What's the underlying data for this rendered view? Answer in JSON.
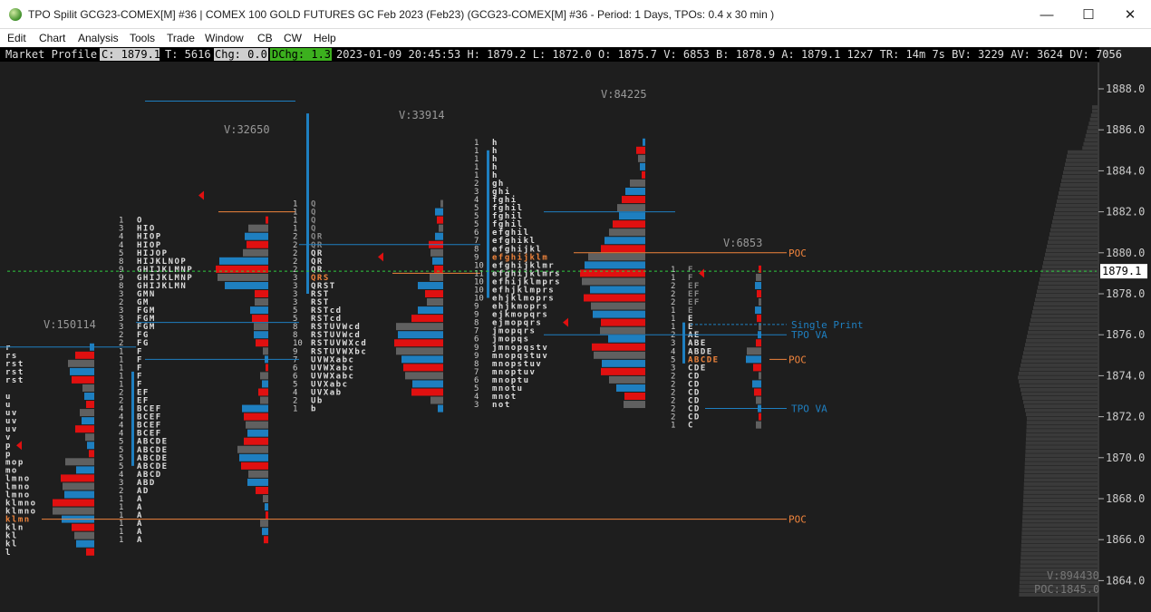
{
  "window": {
    "title": "TPO Spilit GCG23-COMEX[M] #36 | COMEX 100 GOLD FUTURES GC Feb 2023 (Feb23) (GCG23-COMEX[M] #36 - Period: 1 Days, TPOs: 0.4 x 30 min  )",
    "minimize": "—",
    "maximize": "☐",
    "close": "✕",
    "app_icon": "globe-icon"
  },
  "menu": [
    "Edit",
    "Chart",
    "Analysis",
    "Tools",
    "Trade",
    "Window",
    "CB",
    "CW",
    "Help"
  ],
  "status": {
    "label": "Market Profile",
    "c": "C: 1879.1",
    "t": "T: 5616",
    "chg": "Chg: 0.0",
    "dchg": "DChg: 1.3",
    "rest": "2023-01-09 20:45:53 H: 1879.2 L: 1872.0 O: 1875.7 V: 6853 B: 1878.9 A: 1879.1 12x7 TR: 14m 7s BV: 3229 AV: 3624 DV: 7056"
  },
  "price_axis": {
    "ticks": [
      "1888.0",
      "1886.0",
      "1884.0",
      "1882.0",
      "1880.0",
      "1878.0",
      "1876.0",
      "1874.0",
      "1872.0",
      "1870.0",
      "1868.0",
      "1866.0",
      "1864.0"
    ],
    "current": "1879.1"
  },
  "volume_labels": [
    "V:150114",
    "V:32650",
    "V:33914",
    "V:84225",
    "V:6853"
  ],
  "annotations": {
    "poc": "POC",
    "tpo_va": "TPO VA",
    "single_print": "Single Print"
  },
  "footer": {
    "total_volume": "V:894430",
    "poc_price": "POC:1845.0"
  },
  "colors": {
    "background": "#1e1e1e",
    "blue": "#1e7fc0",
    "red": "#e01010",
    "gray": "#606060",
    "orange": "#f0843c",
    "green_dotted": "#2ecc40",
    "status_green": "#3cb01e"
  },
  "profiles": [
    {
      "rows": [
        {
          "c": "",
          "l": "r"
        },
        {
          "c": "",
          "l": "rs"
        },
        {
          "c": "",
          "l": "rst"
        },
        {
          "c": "",
          "l": "rst"
        },
        {
          "c": "",
          "l": "rst"
        },
        {
          "c": "",
          "l": ""
        },
        {
          "c": "",
          "l": "u"
        },
        {
          "c": "",
          "l": "u"
        },
        {
          "c": "",
          "l": "uv"
        },
        {
          "c": "",
          "l": "uv"
        },
        {
          "c": "",
          "l": "uv"
        },
        {
          "c": "",
          "l": "v"
        },
        {
          "c": "",
          "l": "p"
        },
        {
          "c": "",
          "l": "p"
        },
        {
          "c": "",
          "l": "mop"
        },
        {
          "c": "",
          "l": "mo"
        },
        {
          "c": "",
          "l": "lmno"
        },
        {
          "c": "",
          "l": "lmno"
        },
        {
          "c": "",
          "l": "lmno"
        },
        {
          "c": "",
          "l": "klmno"
        },
        {
          "c": "",
          "l": "klmno"
        },
        {
          "c": "",
          "l": "klmn"
        },
        {
          "c": "",
          "l": "kln"
        },
        {
          "c": "",
          "l": "kl"
        },
        {
          "c": "",
          "l": "kl"
        },
        {
          "c": "",
          "l": "l"
        }
      ]
    },
    {
      "rows": [
        {
          "c": "1",
          "l": "O"
        },
        {
          "c": "3",
          "l": "HIO"
        },
        {
          "c": "4",
          "l": "HIOP"
        },
        {
          "c": "4",
          "l": "HIOP"
        },
        {
          "c": "5",
          "l": "HIJOP"
        },
        {
          "c": "8",
          "l": "HIJKLNOP"
        },
        {
          "c": "9",
          "l": "GHIJKLMNP"
        },
        {
          "c": "9",
          "l": "GHIJKLMNP"
        },
        {
          "c": "8",
          "l": "GHIJKLMN"
        },
        {
          "c": "3",
          "l": "GMN"
        },
        {
          "c": "2",
          "l": "GM"
        },
        {
          "c": "3",
          "l": "FGM"
        },
        {
          "c": "3",
          "l": "FGM"
        },
        {
          "c": "3",
          "l": "FGM"
        },
        {
          "c": "2",
          "l": "FG"
        },
        {
          "c": "2",
          "l": "FG"
        },
        {
          "c": "1",
          "l": "F"
        },
        {
          "c": "1",
          "l": "F"
        },
        {
          "c": "1",
          "l": "F"
        },
        {
          "c": "1",
          "l": "F"
        },
        {
          "c": "1",
          "l": "F"
        },
        {
          "c": "2",
          "l": "EF"
        },
        {
          "c": "2",
          "l": "EF"
        },
        {
          "c": "4",
          "l": "BCEF"
        },
        {
          "c": "4",
          "l": "BCEF"
        },
        {
          "c": "4",
          "l": "BCEF"
        },
        {
          "c": "4",
          "l": "BCEF"
        },
        {
          "c": "5",
          "l": "ABCDE"
        },
        {
          "c": "5",
          "l": "ABCDE"
        },
        {
          "c": "5",
          "l": "ABCDE"
        },
        {
          "c": "5",
          "l": "ABCDE"
        },
        {
          "c": "4",
          "l": "ABCD"
        },
        {
          "c": "3",
          "l": "ABD"
        },
        {
          "c": "2",
          "l": "AD"
        },
        {
          "c": "1",
          "l": "A"
        },
        {
          "c": "1",
          "l": "A"
        },
        {
          "c": "1",
          "l": "A"
        },
        {
          "c": "1",
          "l": "A"
        },
        {
          "c": "1",
          "l": "A"
        },
        {
          "c": "1",
          "l": "A"
        }
      ]
    },
    {
      "rows": [
        {
          "c": "1",
          "l": "Q"
        },
        {
          "c": "1",
          "l": "Q"
        },
        {
          "c": "1",
          "l": "Q"
        },
        {
          "c": "1",
          "l": "Q"
        },
        {
          "c": "2",
          "l": "QR"
        },
        {
          "c": "2",
          "l": "QR"
        },
        {
          "c": "2",
          "l": "QR"
        },
        {
          "c": "2",
          "l": "QR"
        },
        {
          "c": "2",
          "l": "QR"
        },
        {
          "c": "3",
          "l": "QRS"
        },
        {
          "c": "3",
          "l": "QRST"
        },
        {
          "c": "3",
          "l": "RST"
        },
        {
          "c": "3",
          "l": "RST"
        },
        {
          "c": "5",
          "l": "RSTcd"
        },
        {
          "c": "5",
          "l": "RSTcd"
        },
        {
          "c": "8",
          "l": "RSTUVWcd"
        },
        {
          "c": "8",
          "l": "RSTUVWcd"
        },
        {
          "c": "10",
          "l": "RSTUVWXcd"
        },
        {
          "c": "9",
          "l": "RSTUVWXbc"
        },
        {
          "c": "7",
          "l": "UVWXabc"
        },
        {
          "c": "6",
          "l": "UVWXabc"
        },
        {
          "c": "6",
          "l": "UVWXabc"
        },
        {
          "c": "5",
          "l": "UVXabc"
        },
        {
          "c": "4",
          "l": "UVXab"
        },
        {
          "c": "2",
          "l": "Ub"
        },
        {
          "c": "1",
          "l": "b"
        }
      ]
    },
    {
      "rows": [
        {
          "c": "1",
          "l": "h"
        },
        {
          "c": "1",
          "l": "h"
        },
        {
          "c": "1",
          "l": "h"
        },
        {
          "c": "1",
          "l": "h"
        },
        {
          "c": "1",
          "l": "h"
        },
        {
          "c": "2",
          "l": "gh"
        },
        {
          "c": "3",
          "l": "ghi"
        },
        {
          "c": "4",
          "l": "fghi"
        },
        {
          "c": "5",
          "l": "fghil"
        },
        {
          "c": "5",
          "l": "fghil"
        },
        {
          "c": "5",
          "l": "fghil"
        },
        {
          "c": "6",
          "l": "efghil"
        },
        {
          "c": "7",
          "l": "efghikl"
        },
        {
          "c": "8",
          "l": "efghijkl"
        },
        {
          "c": "9",
          "l": "efghijklm"
        },
        {
          "c": "10",
          "l": "efghijklmr"
        },
        {
          "c": "11",
          "l": "efghijklmrs"
        },
        {
          "c": "10",
          "l": "efhijklmprs"
        },
        {
          "c": "10",
          "l": "efhjklmprs"
        },
        {
          "c": "10",
          "l": "ehjklmoprs"
        },
        {
          "c": "9",
          "l": "ehjkmoprs"
        },
        {
          "c": "9",
          "l": "ejkmopqrs"
        },
        {
          "c": "8",
          "l": "ejmopqrs"
        },
        {
          "c": "7",
          "l": "jmopqrs"
        },
        {
          "c": "6",
          "l": "jmopqs"
        },
        {
          "c": "9",
          "l": "jmnopqstv"
        },
        {
          "c": "9",
          "l": "mnopqstuv"
        },
        {
          "c": "8",
          "l": "mnopstuv"
        },
        {
          "c": "7",
          "l": "mnoptuv"
        },
        {
          "c": "6",
          "l": "mnoptu"
        },
        {
          "c": "5",
          "l": "mnotu"
        },
        {
          "c": "4",
          "l": "mnot"
        },
        {
          "c": "3",
          "l": "not"
        }
      ]
    },
    {
      "rows": [
        {
          "c": "1",
          "l": "F"
        },
        {
          "c": "1",
          "l": "F"
        },
        {
          "c": "2",
          "l": "EF"
        },
        {
          "c": "2",
          "l": "EF"
        },
        {
          "c": "2",
          "l": "EF"
        },
        {
          "c": "1",
          "l": "E"
        },
        {
          "c": "1",
          "l": "E"
        },
        {
          "c": "1",
          "l": "E"
        },
        {
          "c": "2",
          "l": "AE"
        },
        {
          "c": "3",
          "l": "ABE"
        },
        {
          "c": "4",
          "l": "ABDE"
        },
        {
          "c": "5",
          "l": "ABCDE"
        },
        {
          "c": "3",
          "l": "CDE"
        },
        {
          "c": "2",
          "l": "CD"
        },
        {
          "c": "2",
          "l": "CD"
        },
        {
          "c": "2",
          "l": "CD"
        },
        {
          "c": "2",
          "l": "CD"
        },
        {
          "c": "2",
          "l": "CD"
        },
        {
          "c": "2",
          "l": "CD"
        },
        {
          "c": "1",
          "l": "C"
        }
      ]
    }
  ]
}
